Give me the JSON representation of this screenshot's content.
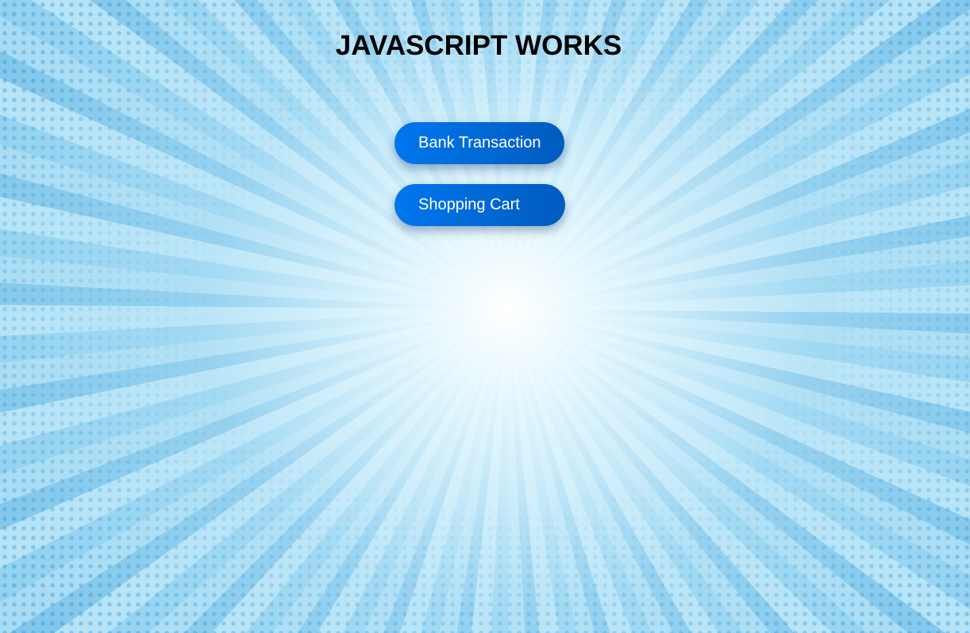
{
  "header": {
    "title": "JAVASCRIPT WORKS"
  },
  "buttons": [
    {
      "label": "Bank Transaction"
    },
    {
      "label": "Shopping Cart"
    }
  ],
  "colors": {
    "button_start": "#0077ee",
    "button_end": "#005bbf",
    "background": "#8fd0ef"
  }
}
